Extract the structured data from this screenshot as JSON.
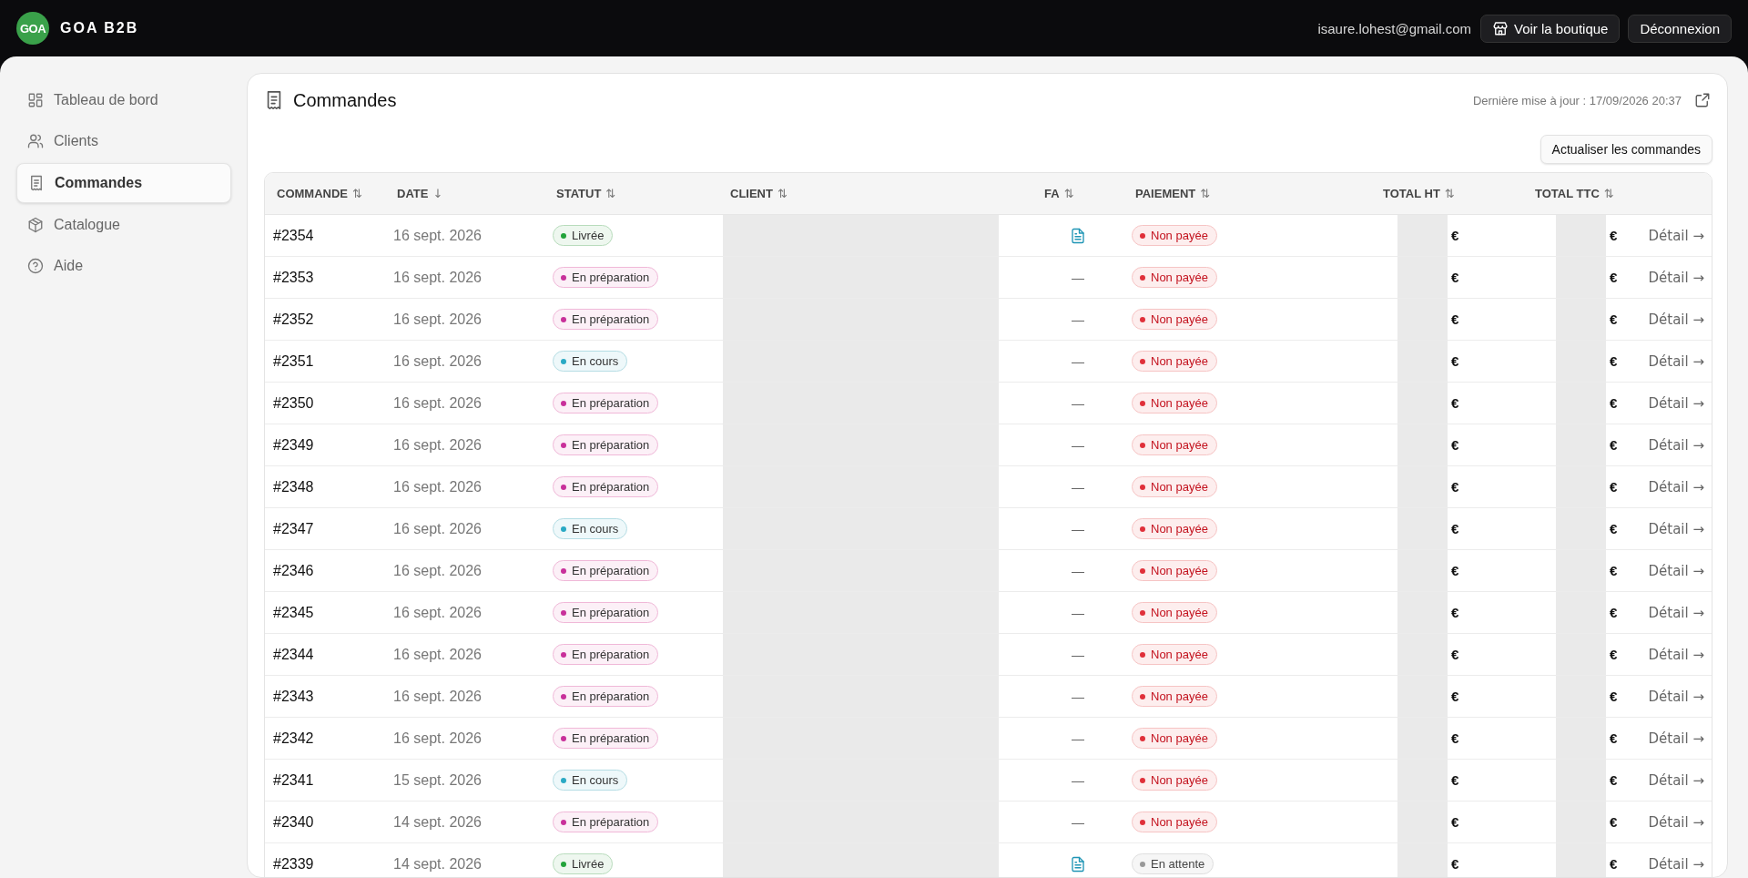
{
  "brand": {
    "logo": "GOA",
    "name": "GOA B2B"
  },
  "topbar": {
    "email": "isaure.lohest@gmail.com",
    "buttons": [
      {
        "label": "Voir la boutique",
        "kind": "shop"
      },
      {
        "label": "Déconnexion",
        "kind": "plain"
      }
    ]
  },
  "sidebar": {
    "items": [
      {
        "label": "Tableau de bord",
        "kind": "dashboard",
        "selected": false
      },
      {
        "label": "Clients",
        "kind": "users",
        "selected": false
      },
      {
        "label": "Commandes",
        "kind": "orders",
        "selected": true
      },
      {
        "label": "Catalogue",
        "kind": "box",
        "selected": false
      },
      {
        "label": "Aide",
        "kind": "help",
        "selected": false
      }
    ]
  },
  "page": {
    "title": "Commandes",
    "last_update": "Dernière mise à jour : 17/09/2026 20:37",
    "refresh_button": "Actualiser les commandes"
  },
  "table": {
    "columns": [
      {
        "label": "COMMANDE",
        "sort_icon": "⇅"
      },
      {
        "label": "DATE",
        "sort_icon": "↓"
      },
      {
        "label": "STATUT",
        "sort_icon": "⇅"
      },
      {
        "label": "CLIENT",
        "sort_icon": "⇅"
      },
      {
        "label": "FA",
        "sort_icon": "⇅"
      },
      {
        "label": "PAIEMENT",
        "sort_icon": "⇅"
      },
      {
        "label": "TOTAL HT",
        "sort_icon": "⇅"
      },
      {
        "label": "TOTAL TTC",
        "sort_icon": "⇅"
      }
    ],
    "rows": [
      {
        "order": "#2354",
        "date": "16 sept. 2026",
        "status": {
          "label": "Livrée",
          "kind": "delivered"
        },
        "invoice": true,
        "payment": {
          "label": "Non payée",
          "kind": "unpaid"
        },
        "total_ht": "€",
        "total_ttc": "€",
        "action": "Détail →"
      },
      {
        "order": "#2353",
        "date": "16 sept. 2026",
        "status": {
          "label": "En préparation",
          "kind": "preparing"
        },
        "invoice": false,
        "fa": "—",
        "payment": {
          "label": "Non payée",
          "kind": "unpaid"
        },
        "total_ht": "€",
        "total_ttc": "€",
        "action": "Détail →"
      },
      {
        "order": "#2352",
        "date": "16 sept. 2026",
        "status": {
          "label": "En préparation",
          "kind": "preparing"
        },
        "invoice": false,
        "fa": "—",
        "payment": {
          "label": "Non payée",
          "kind": "unpaid"
        },
        "total_ht": "€",
        "total_ttc": "€",
        "action": "Détail →"
      },
      {
        "order": "#2351",
        "date": "16 sept. 2026",
        "status": {
          "label": "En cours",
          "kind": "in_progress"
        },
        "invoice": false,
        "fa": "—",
        "payment": {
          "label": "Non payée",
          "kind": "unpaid"
        },
        "total_ht": "€",
        "total_ttc": "€",
        "action": "Détail →"
      },
      {
        "order": "#2350",
        "date": "16 sept. 2026",
        "status": {
          "label": "En préparation",
          "kind": "preparing"
        },
        "invoice": false,
        "fa": "—",
        "payment": {
          "label": "Non payée",
          "kind": "unpaid"
        },
        "total_ht": "€",
        "total_ttc": "€",
        "action": "Détail →"
      },
      {
        "order": "#2349",
        "date": "16 sept. 2026",
        "status": {
          "label": "En préparation",
          "kind": "preparing"
        },
        "invoice": false,
        "fa": "—",
        "payment": {
          "label": "Non payée",
          "kind": "unpaid"
        },
        "total_ht": "€",
        "total_ttc": "€",
        "action": "Détail →"
      },
      {
        "order": "#2348",
        "date": "16 sept. 2026",
        "status": {
          "label": "En préparation",
          "kind": "preparing"
        },
        "invoice": false,
        "fa": "—",
        "payment": {
          "label": "Non payée",
          "kind": "unpaid"
        },
        "total_ht": "€",
        "total_ttc": "€",
        "action": "Détail →"
      },
      {
        "order": "#2347",
        "date": "16 sept. 2026",
        "status": {
          "label": "En cours",
          "kind": "in_progress"
        },
        "invoice": false,
        "fa": "—",
        "payment": {
          "label": "Non payée",
          "kind": "unpaid"
        },
        "total_ht": "€",
        "total_ttc": "€",
        "action": "Détail →"
      },
      {
        "order": "#2346",
        "date": "16 sept. 2026",
        "status": {
          "label": "En préparation",
          "kind": "preparing"
        },
        "invoice": false,
        "fa": "—",
        "payment": {
          "label": "Non payée",
          "kind": "unpaid"
        },
        "total_ht": "€",
        "total_ttc": "€",
        "action": "Détail →"
      },
      {
        "order": "#2345",
        "date": "16 sept. 2026",
        "status": {
          "label": "En préparation",
          "kind": "preparing"
        },
        "invoice": false,
        "fa": "—",
        "payment": {
          "label": "Non payée",
          "kind": "unpaid"
        },
        "total_ht": "€",
        "total_ttc": "€",
        "action": "Détail →"
      },
      {
        "order": "#2344",
        "date": "16 sept. 2026",
        "status": {
          "label": "En préparation",
          "kind": "preparing"
        },
        "invoice": false,
        "fa": "—",
        "payment": {
          "label": "Non payée",
          "kind": "unpaid"
        },
        "total_ht": "€",
        "total_ttc": "€",
        "action": "Détail →"
      },
      {
        "order": "#2343",
        "date": "16 sept. 2026",
        "status": {
          "label": "En préparation",
          "kind": "preparing"
        },
        "invoice": false,
        "fa": "—",
        "payment": {
          "label": "Non payée",
          "kind": "unpaid"
        },
        "total_ht": "€",
        "total_ttc": "€",
        "action": "Détail →"
      },
      {
        "order": "#2342",
        "date": "16 sept. 2026",
        "status": {
          "label": "En préparation",
          "kind": "preparing"
        },
        "invoice": false,
        "fa": "—",
        "payment": {
          "label": "Non payée",
          "kind": "unpaid"
        },
        "total_ht": "€",
        "total_ttc": "€",
        "action": "Détail →"
      },
      {
        "order": "#2341",
        "date": "15 sept. 2026",
        "status": {
          "label": "En cours",
          "kind": "in_progress"
        },
        "invoice": false,
        "fa": "—",
        "payment": {
          "label": "Non payée",
          "kind": "unpaid"
        },
        "total_ht": "€",
        "total_ttc": "€",
        "action": "Détail →"
      },
      {
        "order": "#2340",
        "date": "14 sept. 2026",
        "status": {
          "label": "En préparation",
          "kind": "preparing"
        },
        "invoice": false,
        "fa": "—",
        "payment": {
          "label": "Non payée",
          "kind": "unpaid"
        },
        "total_ht": "€",
        "total_ttc": "€",
        "action": "Détail →"
      },
      {
        "order": "#2339",
        "date": "14 sept. 2026",
        "status": {
          "label": "Livrée",
          "kind": "delivered"
        },
        "invoice": true,
        "payment": {
          "label": "En attente",
          "kind": "pending"
        },
        "total_ht": "€",
        "total_ttc": "€",
        "action": "Détail →"
      }
    ]
  }
}
